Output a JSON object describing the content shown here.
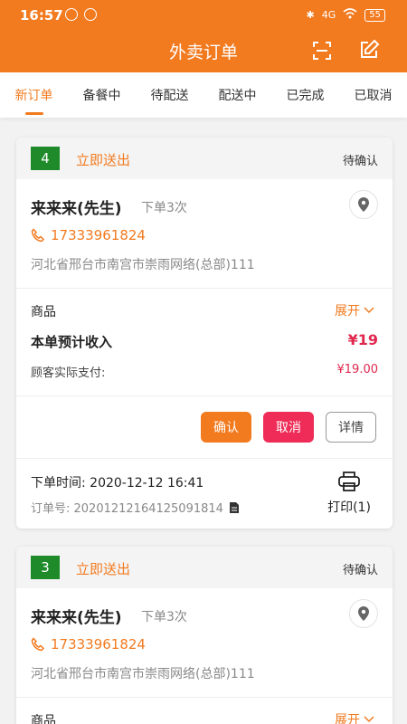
{
  "status_bar": {
    "time": "16:57",
    "network": "4G",
    "battery": "55"
  },
  "header": {
    "title": "外卖订单"
  },
  "tabs": [
    {
      "label": "新订单",
      "active": true
    },
    {
      "label": "备餐中"
    },
    {
      "label": "待配送"
    },
    {
      "label": "配送中"
    },
    {
      "label": "已完成"
    },
    {
      "label": "已取消"
    }
  ],
  "orders": [
    {
      "number": "4",
      "delivery_type": "立即送出",
      "status": "待确认",
      "customer_name": "来来来(先生)",
      "order_count": "下单3次",
      "phone": "17333961824",
      "address": "河北省邢台市南宫市崇雨网络(总部)111",
      "goods_label": "商品",
      "expand_label": "展开",
      "income_label": "本单预计收入",
      "income_value": "¥19",
      "paid_label": "顾客实际支付:",
      "paid_value": "¥19.00",
      "confirm_label": "确认",
      "cancel_label": "取消",
      "detail_label": "详情",
      "order_time": "下单时间:  2020-12-12 16:41",
      "order_no": "订单号:  20201212164125091814",
      "print_label": "打印(1)"
    },
    {
      "number": "3",
      "delivery_type": "立即送出",
      "status": "待确认",
      "customer_name": "来来来(先生)",
      "order_count": "下单3次",
      "phone": "17333961824",
      "address": "河北省邢台市南宫市崇雨网络(总部)111",
      "goods_label": "商品",
      "expand_label": "展开"
    }
  ],
  "colors": {
    "accent": "#f27a1f",
    "badge_green": "#1e8a2a",
    "cancel_red": "#ef2c57",
    "price_red": "#e0284f"
  }
}
